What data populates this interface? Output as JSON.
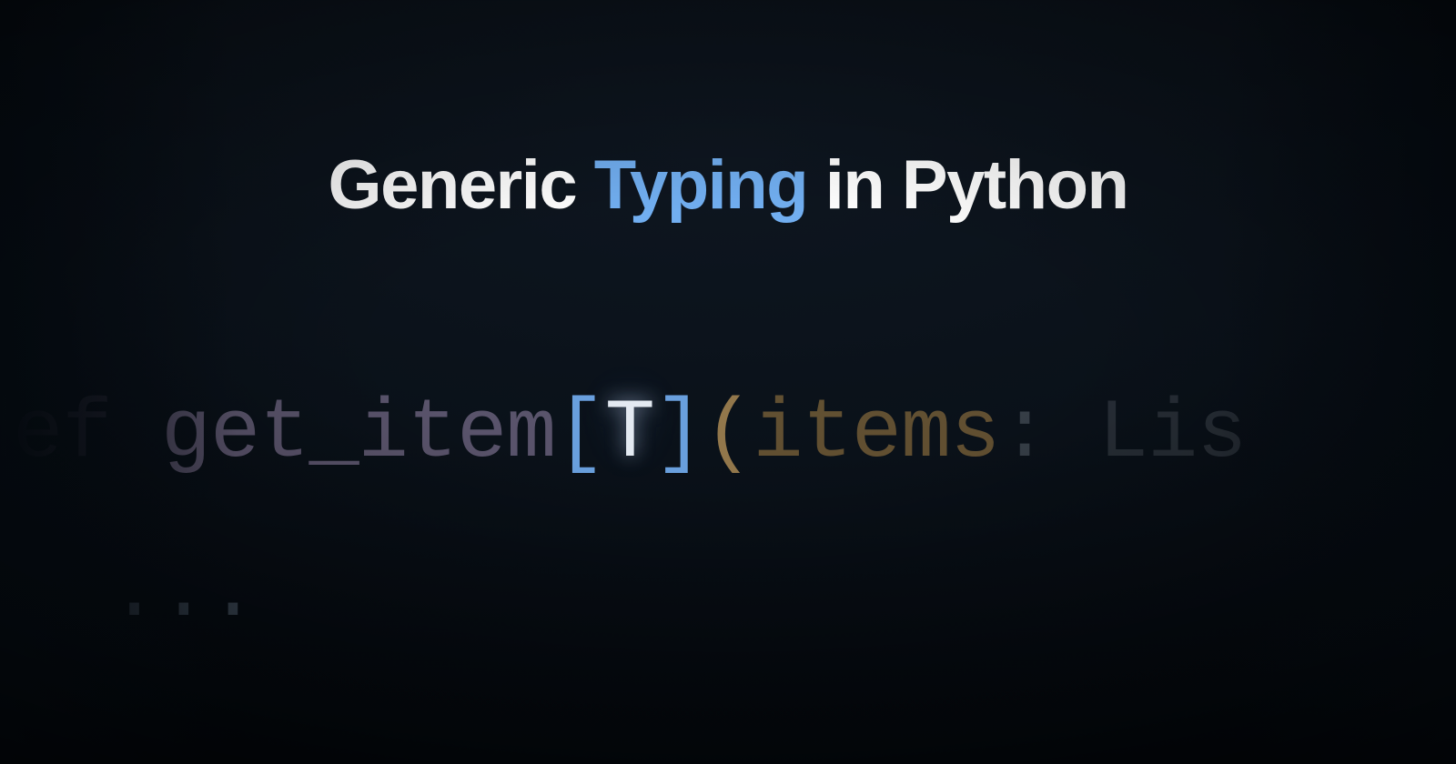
{
  "title": {
    "part1": "Generic ",
    "accent": "Typing",
    "part2": " in Python"
  },
  "code": {
    "line1": {
      "kw": "def ",
      "fn": "get_item",
      "lbr": "[",
      "tparam": "T",
      "rbr": "]",
      "lparen": "(",
      "param": "items",
      "colon": ": ",
      "type": "Lis"
    },
    "line2": {
      "dots": "..."
    }
  }
}
